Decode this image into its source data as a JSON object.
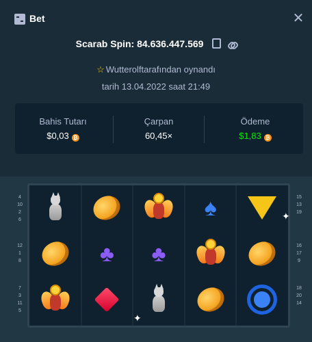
{
  "header": {
    "title": "Bet"
  },
  "spin": {
    "title": "Scarab Spin: 84.636.447.569"
  },
  "played_by": "Wutterolftarafından oynandı",
  "date": "tarih 13.04.2022 saat 21:49",
  "stats": {
    "bet_label": "Bahis Tutarı",
    "bet_value": "$0,03",
    "multiplier_label": "Çarpan",
    "multiplier_value": "60,45×",
    "payout_label": "Ödeme",
    "payout_value": "$1,83",
    "coin_symbol": "₿",
    "payout_color": "#00e701"
  },
  "paylines": {
    "left": [
      [
        "4",
        "10",
        "2",
        "6"
      ],
      [
        "12",
        "1",
        "8"
      ],
      [
        "7",
        "3",
        "11",
        "5"
      ]
    ],
    "right": [
      [
        "15",
        "13",
        "19"
      ],
      [
        "16",
        "17",
        "9"
      ],
      [
        "18",
        "20",
        "14"
      ]
    ]
  },
  "reels": [
    [
      "cat",
      "coin",
      "scarab"
    ],
    [
      "coin",
      "club",
      "diamond"
    ],
    [
      "scarab",
      "club",
      "cat"
    ],
    [
      "spade",
      "scarab",
      "coin"
    ],
    [
      "triangle",
      "coin",
      "ring"
    ]
  ]
}
